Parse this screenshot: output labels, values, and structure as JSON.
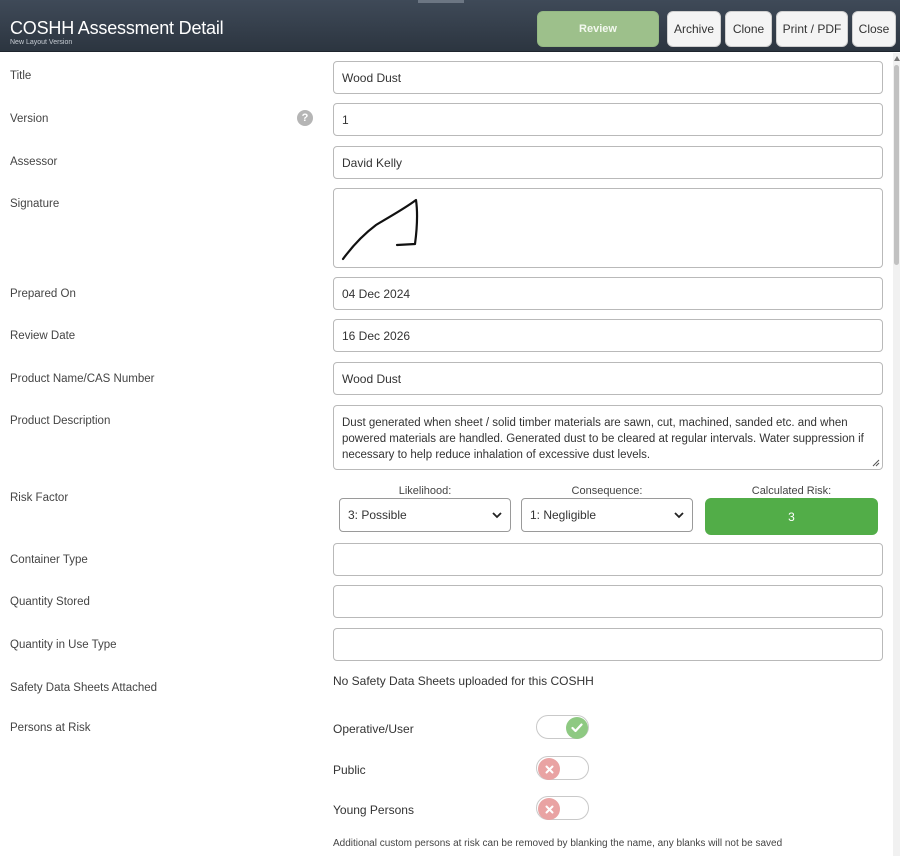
{
  "header": {
    "title": "COSHH Assessment Detail",
    "subtitle": "New Layout Version",
    "buttons": {
      "review": "Review",
      "archive": "Archive",
      "clone": "Clone",
      "print": "Print / PDF",
      "close": "Close"
    }
  },
  "form": {
    "title": {
      "label": "Title",
      "value": "Wood Dust"
    },
    "version": {
      "label": "Version",
      "value": "1",
      "help_icon": "?"
    },
    "assessor": {
      "label": "Assessor",
      "value": "David Kelly"
    },
    "signature": {
      "label": "Signature"
    },
    "prepared_on": {
      "label": "Prepared On",
      "value": "04 Dec 2024"
    },
    "review_date": {
      "label": "Review Date",
      "value": "16 Dec 2026"
    },
    "product_name": {
      "label": "Product Name/CAS Number",
      "value": "Wood Dust"
    },
    "product_description": {
      "label": "Product Description",
      "value": "Dust generated when sheet / solid timber materials are sawn, cut, machined, sanded etc. and when powered materials are handled.  Generated dust to be cleared at regular intervals.  Water suppression if necessary to help reduce inhalation of excessive dust levels."
    },
    "risk_factor": {
      "label": "Risk Factor",
      "likelihood_label": "Likelihood:",
      "likelihood_value": "3: Possible",
      "consequence_label": "Consequence:",
      "consequence_value": "1: Negligible",
      "calculated_label": "Calculated Risk:",
      "calculated_value": "3",
      "calculated_color": "#52ad48"
    },
    "container_type": {
      "label": "Container Type",
      "value": ""
    },
    "quantity_stored": {
      "label": "Quantity Stored",
      "value": ""
    },
    "quantity_in_use": {
      "label": "Quantity in Use Type",
      "value": ""
    },
    "safety_data_sheets": {
      "label": "Safety Data Sheets Attached",
      "value": "No Safety Data Sheets uploaded for this COSHH"
    },
    "persons_at_risk": {
      "label": "Persons at Risk",
      "items": [
        {
          "name": "Operative/User",
          "enabled": true,
          "icon": "check-icon"
        },
        {
          "name": "Public",
          "enabled": false,
          "icon": "cross-icon"
        },
        {
          "name": "Young Persons",
          "enabled": false,
          "icon": "cross-icon"
        }
      ],
      "note": "Additional custom persons at risk can be removed by blanking the name, any blanks will not be saved"
    }
  },
  "colors": {
    "header_bg": "#2c3540",
    "review_button": "#9dc08b",
    "toggle_on": "#8ec982",
    "toggle_off": "#e9a3a3"
  }
}
